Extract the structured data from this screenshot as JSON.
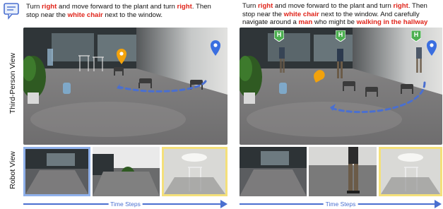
{
  "left": {
    "instruction": [
      {
        "t": "Turn ",
        "h": false
      },
      {
        "t": "right",
        "h": true
      },
      {
        "t": " and move forward to the plant and turn ",
        "h": false
      },
      {
        "t": "right",
        "h": true
      },
      {
        "t": ". Then stop near the ",
        "h": false
      },
      {
        "t": "white chair",
        "h": true
      },
      {
        "t": " next to the window.",
        "h": false
      }
    ],
    "timeline_label": "Time Steps"
  },
  "right": {
    "instruction": [
      {
        "t": "Turn ",
        "h": false
      },
      {
        "t": "right",
        "h": true
      },
      {
        "t": " and move forward to the plant and turn ",
        "h": false
      },
      {
        "t": "right",
        "h": true
      },
      {
        "t": ". Then stop near the ",
        "h": false
      },
      {
        "t": "white chair",
        "h": true
      },
      {
        "t": " next to the window. And carefully navigate around a ",
        "h": false
      },
      {
        "t": "man",
        "h": true
      },
      {
        "t": " who might be ",
        "h": false
      },
      {
        "t": "walking in the hallway",
        "h": true
      }
    ],
    "human_markers": [
      "H",
      "H",
      "H"
    ],
    "timeline_label": "Time Steps"
  },
  "labels": {
    "third_person": "Third-Person View",
    "robot_view": "Robot View"
  },
  "colors": {
    "highlight": "#e0241a",
    "path": "#4a6fd0",
    "start_pin": "#3a6ee0",
    "end_pin": "#f2a20c",
    "human_marker": "#4caf50",
    "thumb_border_start": "#8fb0ea",
    "thumb_border_end": "#f4e07a"
  }
}
